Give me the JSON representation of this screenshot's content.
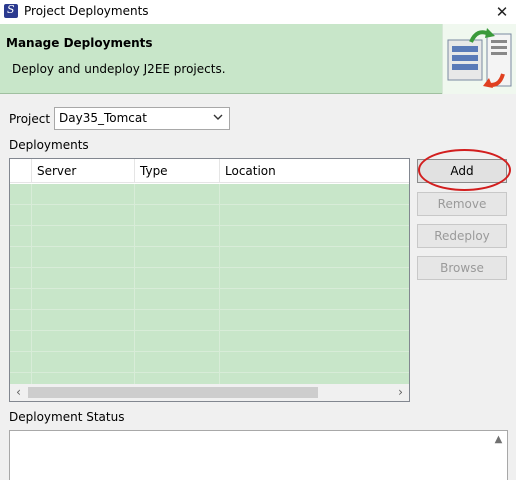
{
  "window": {
    "title": "Project Deployments",
    "close_glyph": "✕"
  },
  "banner": {
    "title": "Manage Deployments",
    "description": "Deploy and undeploy J2EE projects."
  },
  "project": {
    "label": "Project",
    "selected": "Day35_Tomcat"
  },
  "deployments": {
    "label": "Deployments",
    "columns": [
      "",
      "Server",
      "Type",
      "Location"
    ],
    "rows": []
  },
  "buttons": {
    "add": "Add",
    "remove": "Remove",
    "redeploy": "Redeploy",
    "browse": "Browse"
  },
  "status": {
    "label": "Deployment Status"
  },
  "colors": {
    "banner_bg": "#c8e6c9",
    "table_bg": "#c8e6c9",
    "highlight": "#d21e1e"
  }
}
